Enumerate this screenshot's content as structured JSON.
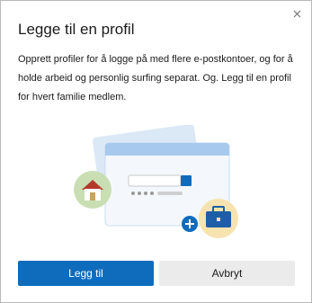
{
  "dialog": {
    "title": "Legge til en profil",
    "description": "Opprett profiler for å logge på med flere e-postkontoer, og for å holde arbeid og personlig surfing separat. Og. Legg til en profil for hvert familie medlem.",
    "close_icon": "close-icon",
    "illustration_icons": [
      "home-icon",
      "briefcase-icon",
      "plus-icon"
    ]
  },
  "buttons": {
    "add_label": "Legg til",
    "cancel_label": "Avbryt"
  },
  "colors": {
    "accent": "#0f6cbd",
    "secondary_button": "#ebebeb",
    "home_badge": "#c9dfb3",
    "briefcase_badge": "#f7e3b0",
    "window_back": "#dbe8f6",
    "window_front": "#f4f8fd"
  }
}
